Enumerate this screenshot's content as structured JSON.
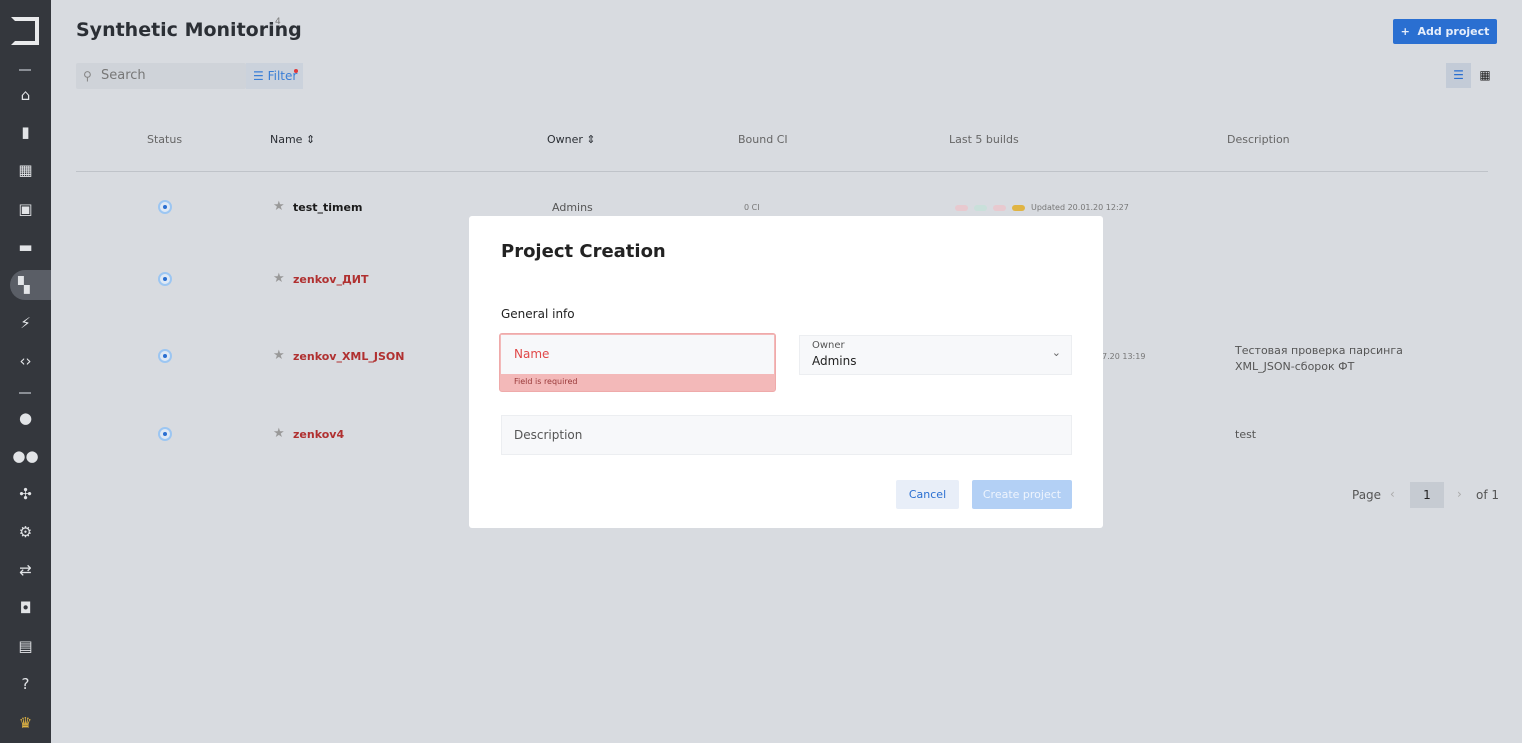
{
  "sidebar": {
    "items": [
      "home-icon",
      "monitor-icon",
      "building-icon",
      "archive-icon",
      "ruler-icon",
      "dashboard-icon",
      "lightning-icon",
      "code-icon",
      "user-icon",
      "users-icon",
      "network-icon",
      "gear-icon",
      "swap-icon",
      "android-icon",
      "chat-icon",
      "help-icon",
      "crown-icon"
    ]
  },
  "header": {
    "title": "Synthetic Monitoring",
    "count": "4",
    "add_project": "Add project"
  },
  "search": {
    "placeholder": "Search",
    "filter": "Filter"
  },
  "table": {
    "columns": {
      "status": "Status",
      "name": "Name",
      "owner": "Owner",
      "bound_ci": "Bound CI",
      "last_builds": "Last 5 builds",
      "description": "Description"
    },
    "rows": [
      {
        "name": "test_timem",
        "owner": "Admins",
        "ci": "0 CI",
        "updated": "Updated 20.01.20 12:27",
        "description": ""
      },
      {
        "name": "zenkov_ДИТ",
        "owner": "",
        "ci": "",
        "updated": "",
        "description": ""
      },
      {
        "name": "zenkov_XML_JSON",
        "owner": "",
        "ci": "",
        "updated": "7.20 13:19",
        "description": "Тестовая проверка парсинга XML_JSON-сборок ФТ"
      },
      {
        "name": "zenkov4",
        "owner": "",
        "ci": "",
        "updated": "",
        "description": "test"
      }
    ],
    "build_colors": [
      "#e8c9cf",
      "#c9e0da",
      "#e8c9cf",
      "#e0b443"
    ]
  },
  "pagination": {
    "page_label": "Page",
    "current": "1",
    "of": "of 1"
  },
  "modal": {
    "title": "Project Creation",
    "section": "General info",
    "name_placeholder": "Name",
    "name_error": "Field is required",
    "owner_label": "Owner",
    "owner_value": "Admins",
    "description_placeholder": "Description",
    "cancel": "Cancel",
    "create": "Create project"
  }
}
